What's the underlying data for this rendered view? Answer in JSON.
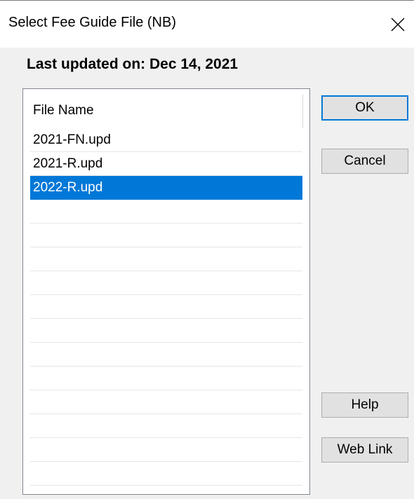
{
  "window": {
    "title": "Select Fee Guide File (NB)",
    "close_icon": "close-icon"
  },
  "status": {
    "last_updated": "Last updated on: Dec 14, 2021"
  },
  "file_list": {
    "header": "File Name",
    "items": [
      {
        "name": "2021-FN.upd",
        "selected": false
      },
      {
        "name": "2021-R.upd",
        "selected": false
      },
      {
        "name": "2022-R.upd",
        "selected": true
      }
    ]
  },
  "buttons": {
    "ok": "OK",
    "cancel": "Cancel",
    "help": "Help",
    "web_link": "Web Link"
  },
  "colors": {
    "selection": "#0078d7",
    "default_button_border": "#0078d7"
  }
}
